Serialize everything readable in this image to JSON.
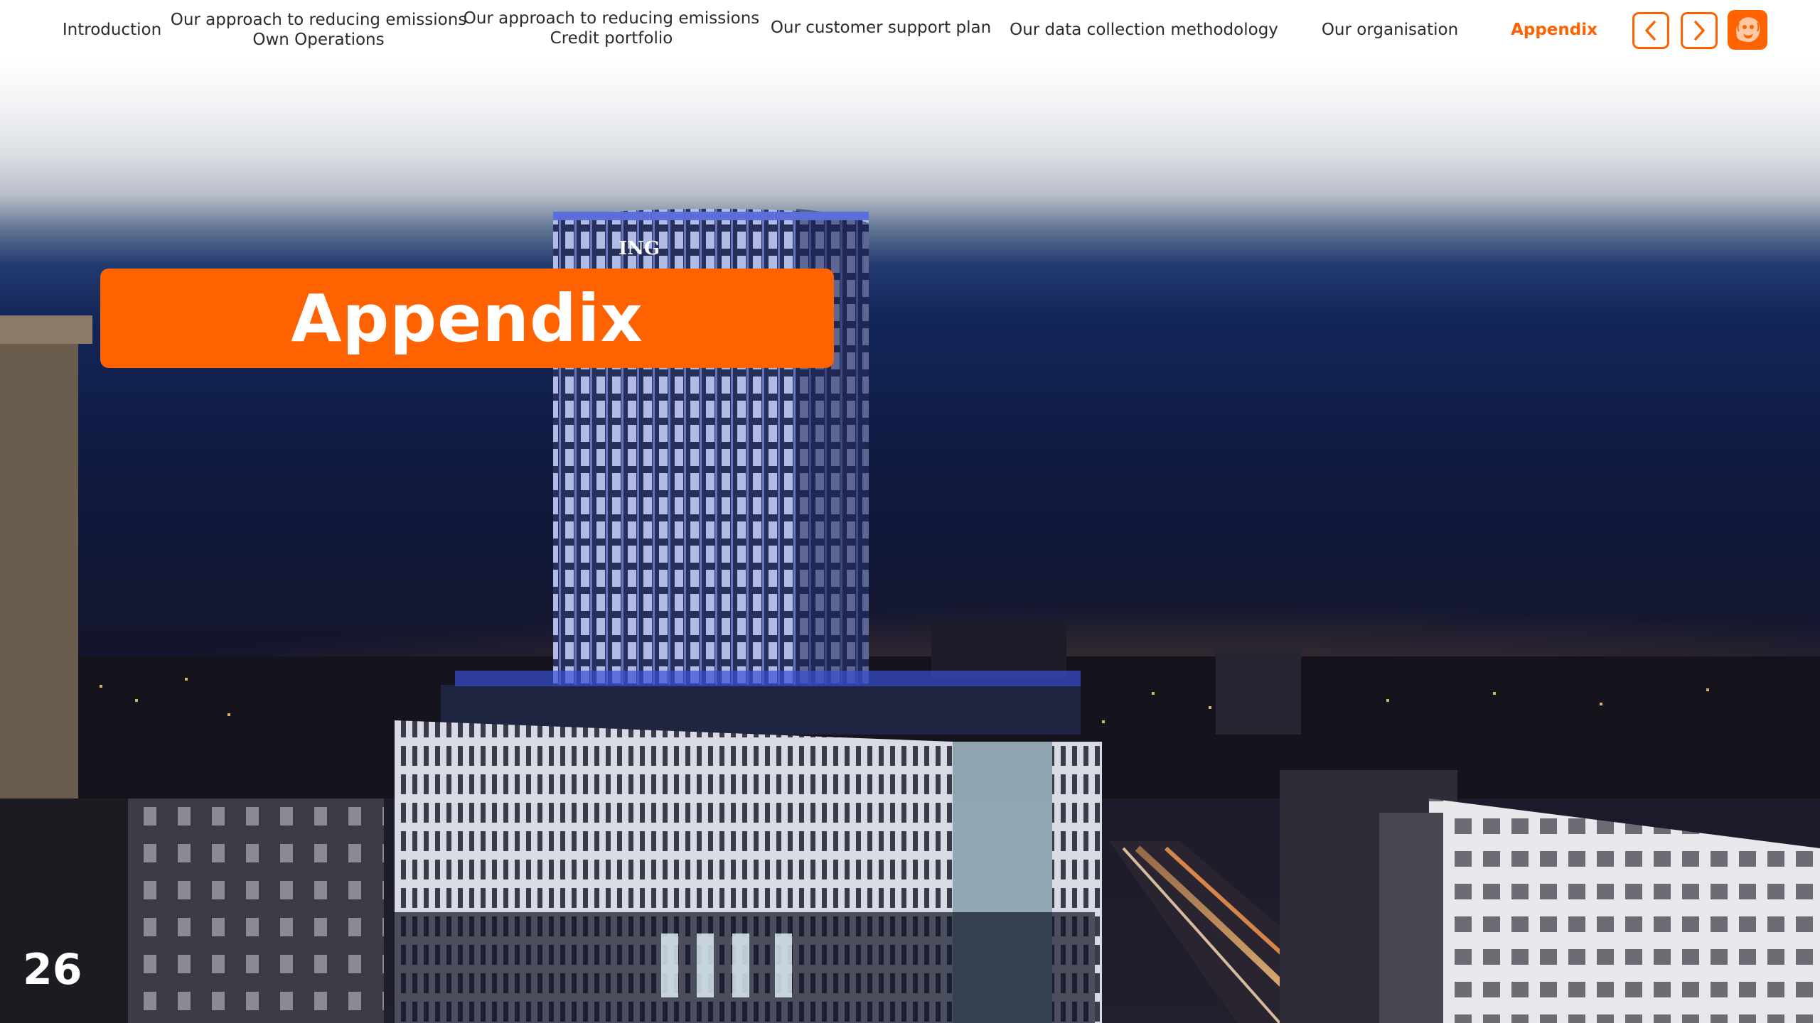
{
  "nav": {
    "items": [
      {
        "label": "Introduction",
        "sub": ""
      },
      {
        "label": "Our approach to reducing emissions",
        "sub": "Own Operations"
      },
      {
        "label": "Our approach to reducing emissions",
        "sub": "Credit portfolio"
      },
      {
        "label": "Our customer support plan",
        "sub": ""
      },
      {
        "label": "Our data collection methodology",
        "sub": ""
      },
      {
        "label": "Our organisation",
        "sub": ""
      },
      {
        "label": "Appendix",
        "sub": ""
      }
    ],
    "active_index": 6,
    "prev_icon": "chevron-left-icon",
    "next_icon": "chevron-right-icon",
    "logo_icon": "lion-logo-icon"
  },
  "hero": {
    "building_sign": "ING"
  },
  "section": {
    "title": "Appendix"
  },
  "page": {
    "number": "26"
  },
  "colors": {
    "accent": "#ff6200",
    "text": "#2b2b2b",
    "sky_dark": "#101634"
  }
}
